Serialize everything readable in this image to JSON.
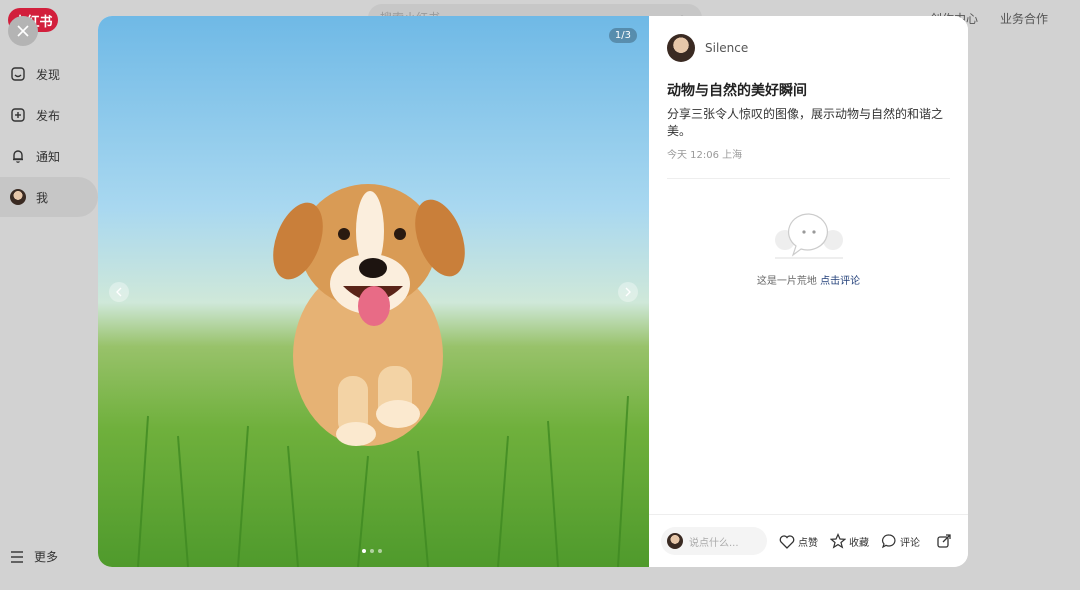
{
  "app": {
    "logo_text": "小红书",
    "search_placeholder": "搜索小红书",
    "top_nav": [
      "创作中心",
      "业务合作"
    ]
  },
  "sidebar": {
    "items": [
      {
        "label": "发现",
        "icon": "discover-icon"
      },
      {
        "label": "发布",
        "icon": "plus-square-icon"
      },
      {
        "label": "通知",
        "icon": "bell-icon"
      },
      {
        "label": "我",
        "icon": "avatar"
      }
    ],
    "more_label": "更多"
  },
  "note": {
    "image_counter": "1/3",
    "author": "Silence",
    "title": "动物与自然的美好瞬间",
    "description": "分享三张令人惊叹的图像，展示动物与自然的和谐之美。",
    "meta": "今天 12:06 上海",
    "empty_text": "这是一片荒地",
    "empty_link": "点击评论"
  },
  "actions": {
    "comment_placeholder": "说点什么...",
    "like": "点赞",
    "collect": "收藏",
    "comment": "评论"
  }
}
